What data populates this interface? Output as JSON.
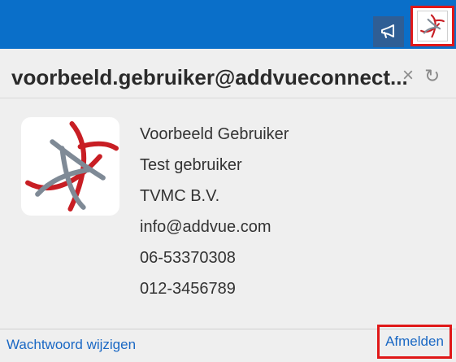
{
  "header": {
    "notifications_icon": "megaphone-icon",
    "avatar_icon": "addvue-logo-icon"
  },
  "account": {
    "email": "voorbeeld.gebruiker@addvueconnect...",
    "close_glyph": "×",
    "refresh_glyph": "↻",
    "details": [
      "Voorbeeld Gebruiker",
      "Test gebruiker",
      "TVMC B.V.",
      "info@addvue.com",
      "06-53370308",
      "012-3456789"
    ]
  },
  "footer": {
    "change_password_label": "Wachtwoord wijzigen",
    "logout_label": "Afmelden"
  },
  "colors": {
    "topbar": "#0a6fc9",
    "link": "#1a68c4",
    "highlight": "#e01818",
    "logo_red": "#c81e24",
    "logo_gray": "#7f8a96"
  }
}
